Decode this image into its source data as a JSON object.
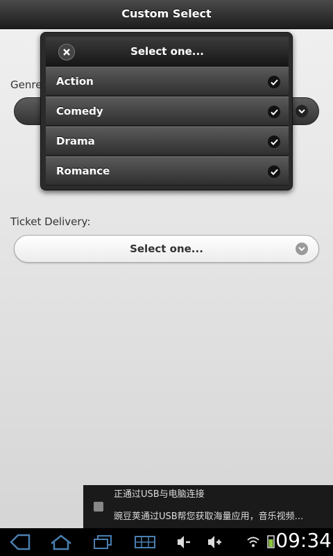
{
  "title": "Custom Select",
  "genre_label": "Genre",
  "ticket_label": "Ticket Delivery:",
  "ticket_select_value": "Select one...",
  "popup": {
    "header": "Select one...",
    "options": [
      "Action",
      "Comedy",
      "Drama",
      "Romance"
    ]
  },
  "notification": {
    "line1": "正通过USB与电脑连接",
    "line2": "豌豆荚通过USB帮您获取海量应用，音乐视频..."
  },
  "status": {
    "time": "09:34"
  },
  "colors": {
    "accent_battery": "#8dc63f"
  }
}
